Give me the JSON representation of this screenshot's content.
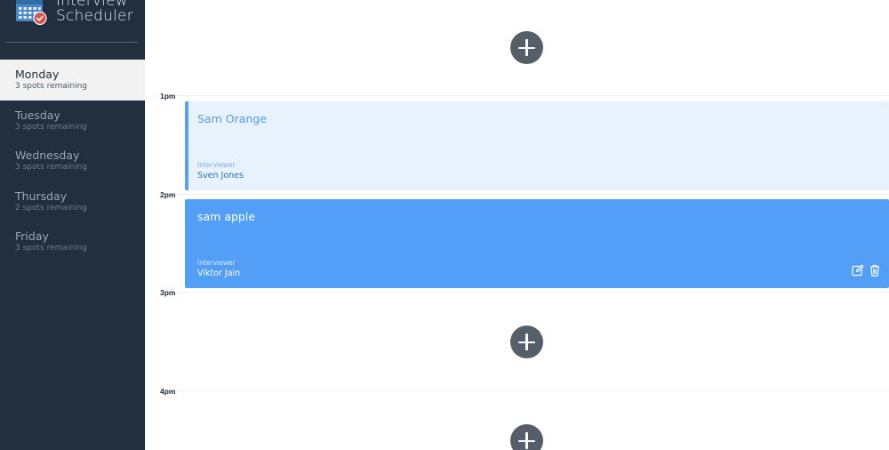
{
  "app": {
    "title_line1": "Interview",
    "title_line2": "Scheduler",
    "logo_icon": "calendar-check-icon"
  },
  "colors": {
    "sidebar_bg": "#222f3e",
    "selected_day_bg": "#f2f2f2",
    "appointment_light": "#e8f2fc",
    "appointment_dark": "#539ff7",
    "add_button": "#565f68"
  },
  "days": [
    {
      "name": "Monday",
      "spots": "3 spots remaining",
      "selected": true
    },
    {
      "name": "Tuesday",
      "spots": "3 spots remaining",
      "selected": false
    },
    {
      "name": "Wednesday",
      "spots": "3 spots remaining",
      "selected": false
    },
    {
      "name": "Thursday",
      "spots": "2 spots remaining",
      "selected": false
    },
    {
      "name": "Friday",
      "spots": "3 spots remaining",
      "selected": false
    }
  ],
  "schedule": {
    "hours": [
      "1pm",
      "2pm",
      "3pm",
      "4pm"
    ],
    "appointments": [
      {
        "student": "Sam Orange",
        "interviewer_label": "Interviewer",
        "interviewer": "Sven Jones"
      },
      {
        "student": "sam apple",
        "interviewer_label": "Interviewer",
        "interviewer": "Viktor Jain",
        "actions": [
          "edit-icon",
          "trash-icon"
        ]
      }
    ],
    "empty_slot_action": "plus-icon"
  }
}
